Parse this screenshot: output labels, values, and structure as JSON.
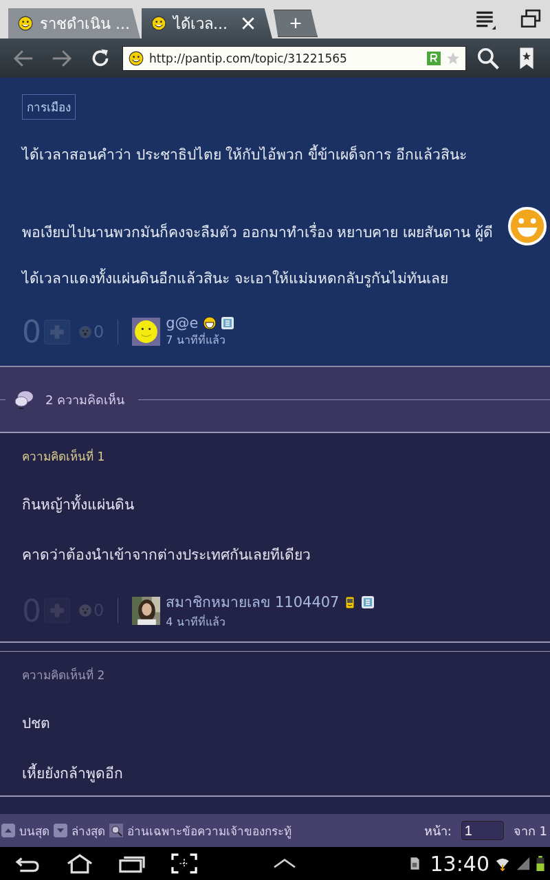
{
  "browser": {
    "tabs": [
      {
        "title": "ราชดำเนิน ...",
        "selected": false
      },
      {
        "title": "ได้เวล...",
        "selected": true
      }
    ],
    "new_tab": "+",
    "url": "http://pantip.com/topic/31221565"
  },
  "post": {
    "tag": "การเมือง",
    "paragraphs": [
      "ได้เวลาสอนคำว่า ประชาธิปไตย ให้กับไอ้พวก ขี้ข้าเผด็จการ อีกแล้วสินะ",
      "พอเงียบไปนานพวกมันก็คงจะลืมตัว ออกมาทำเรื่อง หยาบคาย เผยสันดาน ผู้ดี",
      "ได้เวลาแดงทั้งแผ่นดินอีกแล้วสินะ จะเอาให้แม่มหดกลับรูกันไม่ทันเลย"
    ],
    "score": "0",
    "emotion_count": "0",
    "author": "g@e",
    "time": "7 นาทีที่แล้ว",
    "avatar": {
      "kind": "smiley"
    }
  },
  "comment_count": "2 ความคิดเห็น",
  "comments": [
    {
      "label": "ความคิดเห็นที่ 1",
      "color": "#d9cc8e",
      "paragraphs": [
        "กินหญ้าทั้งแผ่นดิน",
        "คาดว่าต้องนำเข้าจากต่างประเทศกันเลยทีเดียว"
      ],
      "score": "0",
      "emotion_count": "0",
      "author": "สมาชิกหมายเลข 1104407",
      "time": "4 นาทีที่แล้ว",
      "avatar": {
        "kind": "picture"
      }
    },
    {
      "label": "ความคิดเห็นที่ 2",
      "color": "#9896b2",
      "paragraphs": [
        "ปชต",
        "เหี้ยยังกล้าพูดอีก"
      ]
    }
  ],
  "footer": {
    "top": "บนสุด",
    "bottom": "ล่างสุด",
    "owner_only": "อ่านเฉพาะข้อความเจ้าของกระทู้",
    "page_label": "หน้า:",
    "page": "1",
    "of": "จาก 1"
  },
  "status": {
    "time": "13:40"
  }
}
